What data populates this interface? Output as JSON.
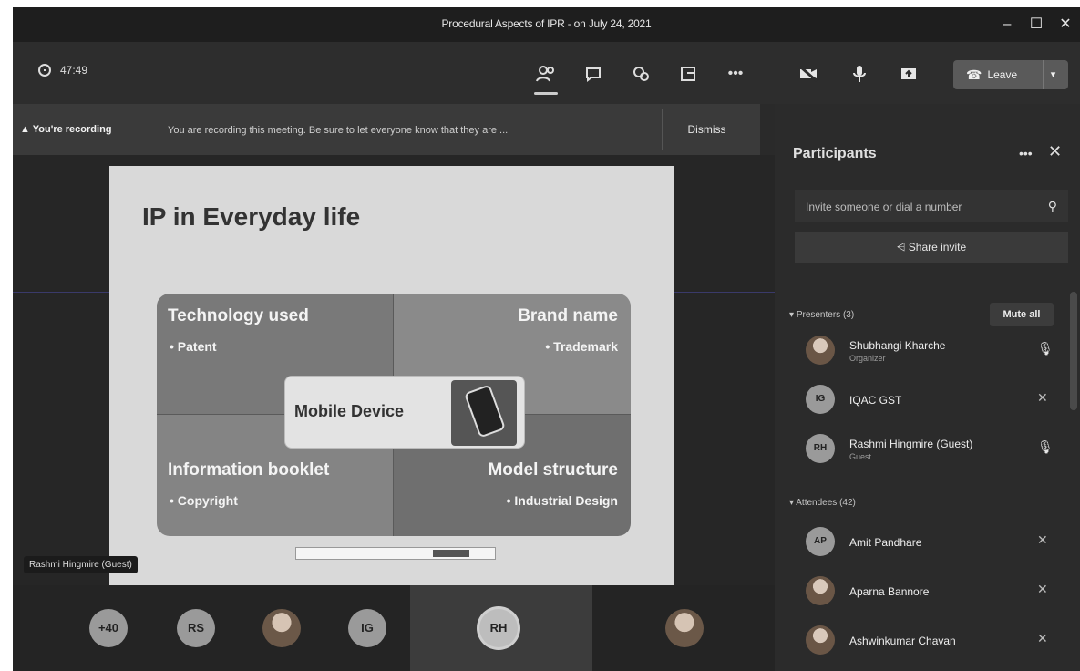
{
  "window": {
    "title": "Procedural Aspects of IPR - on July 24, 2021",
    "controls": [
      "–",
      "☐",
      "✕"
    ]
  },
  "toolbar": {
    "timer": "47:49",
    "leave_label": "Leave"
  },
  "banner": {
    "title": "You're recording",
    "message": "You are recording this meeting. Be sure to let everyone know that they are ...",
    "dismiss": "Dismiss"
  },
  "slide": {
    "title": "IP in Everyday life",
    "cells": [
      {
        "heading": "Technology used",
        "item": "• Patent"
      },
      {
        "heading": "Brand name",
        "item": "• Trademark"
      },
      {
        "heading": "Information booklet",
        "item": "• Copyright"
      },
      {
        "heading": "Model structure",
        "item": "• Industrial Design"
      }
    ],
    "center": "Mobile Device"
  },
  "stage": {
    "presenter_tag": "Rashmi Hingmire (Guest)"
  },
  "strip": {
    "items": [
      "+40",
      "RS",
      "IG",
      "RH"
    ]
  },
  "participants": {
    "title": "Participants",
    "search_placeholder": "Invite someone or dial a number",
    "share_invite": "Share invite",
    "presenters_label": "Presenters (3)",
    "mute_all": "Mute all",
    "presenters": [
      {
        "initials": "",
        "name": "Shubhangi Kharche",
        "sub": "Organizer",
        "mic": "on"
      },
      {
        "initials": "IG",
        "name": "IQAC GST",
        "sub": "",
        "mic": "off"
      },
      {
        "initials": "RH",
        "name": "Rashmi Hingmire (Guest)",
        "sub": "Guest",
        "mic": "on"
      }
    ],
    "attendees_label": "Attendees (42)",
    "attendees": [
      {
        "initials": "AP",
        "name": "Amit Pandhare",
        "mic": "off"
      },
      {
        "initials": "",
        "name": "Aparna Bannore",
        "mic": "off"
      },
      {
        "initials": "",
        "name": "Ashwinkumar Chavan",
        "mic": "off"
      }
    ]
  },
  "icons": {
    "participants": "people-icon",
    "chat": "chat-icon",
    "reactions": "react-icon",
    "rooms": "rooms-icon",
    "more": "more-icon",
    "camera": "camera-off-icon",
    "mic": "mic-icon",
    "share": "share-tray-icon",
    "leave": "phone-hangup-icon"
  }
}
